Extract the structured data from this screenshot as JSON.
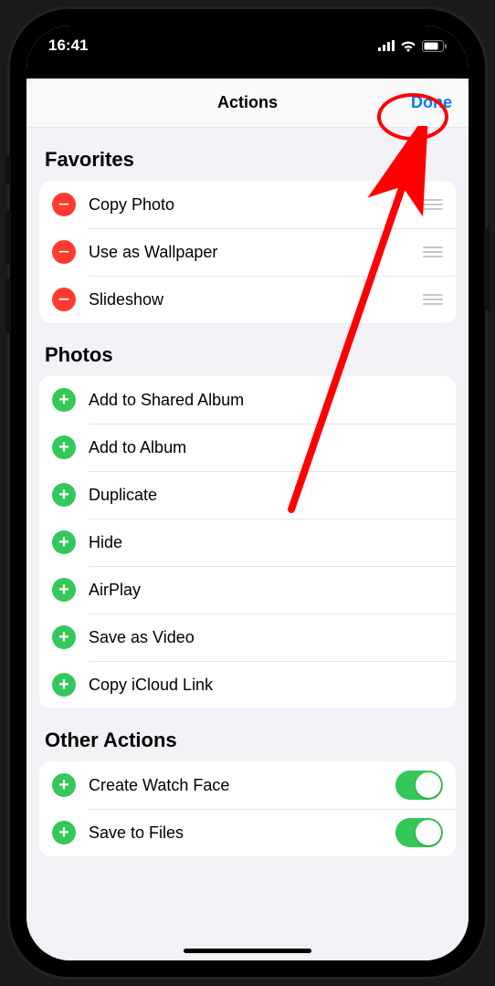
{
  "status": {
    "time": "16:41"
  },
  "nav": {
    "title": "Actions",
    "done": "Done"
  },
  "sections": {
    "favorites": {
      "header": "Favorites",
      "items": [
        {
          "label": "Copy Photo"
        },
        {
          "label": "Use as Wallpaper"
        },
        {
          "label": "Slideshow"
        }
      ]
    },
    "photos": {
      "header": "Photos",
      "items": [
        {
          "label": "Add to Shared Album"
        },
        {
          "label": "Add to Album"
        },
        {
          "label": "Duplicate"
        },
        {
          "label": "Hide"
        },
        {
          "label": "AirPlay"
        },
        {
          "label": "Save as Video"
        },
        {
          "label": "Copy iCloud Link"
        }
      ]
    },
    "other": {
      "header": "Other Actions",
      "items": [
        {
          "label": "Create Watch Face",
          "toggle": true
        },
        {
          "label": "Save to Files",
          "toggle": true
        }
      ]
    }
  }
}
